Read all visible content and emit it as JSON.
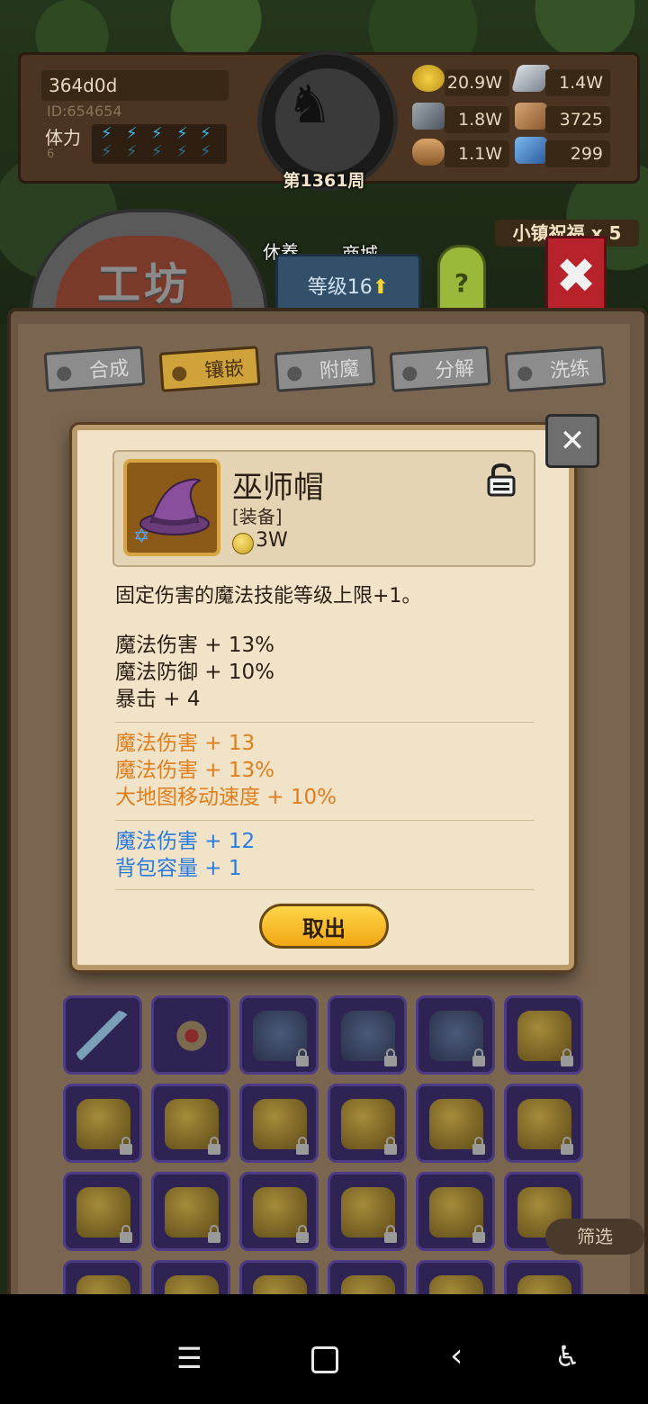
{
  "hud": {
    "player_name": "364d0d",
    "player_id": "ID:654654",
    "stamina_label": "体力",
    "stamina_value": "6",
    "week_label": "第1361周",
    "resources": [
      {
        "icon": "gold-coin-icon",
        "value": "20.9W"
      },
      {
        "icon": "iron-ingot-icon",
        "value": "1.4W"
      },
      {
        "icon": "ore-icon",
        "value": "1.8W"
      },
      {
        "icon": "leather-icon",
        "value": "3725"
      },
      {
        "icon": "wood-log-icon",
        "value": "1.1W"
      },
      {
        "icon": "crystal-icon",
        "value": "299"
      }
    ]
  },
  "buildings": {
    "rest_label": "休养",
    "shop_label": "商城",
    "workshop_label": "工坊",
    "level_label": "等级16",
    "help_label": "?",
    "blessing_label": "小镇祝福 x 5"
  },
  "tabs": [
    {
      "label": "合成",
      "active": false
    },
    {
      "label": "镶嵌",
      "active": true
    },
    {
      "label": "附魔",
      "active": false
    },
    {
      "label": "分解",
      "active": false
    },
    {
      "label": "洗练",
      "active": false
    }
  ],
  "modal": {
    "item_name": "巫师帽",
    "item_type": "[装备]",
    "item_price": "3W",
    "description": "固定伤害的魔法技能等级上限+1。",
    "base_stats": [
      "魔法伤害 + 13%",
      "魔法防御 + 10%",
      "暴击 + 4"
    ],
    "orange_stats": [
      "魔法伤害 + 13",
      "魔法伤害 + 13%",
      "大地图移动速度 + 10%"
    ],
    "blue_stats": [
      "魔法伤害 + 12",
      "背包容量 + 1"
    ],
    "takeout_label": "取出"
  },
  "filter_label": "筛选",
  "colors": {
    "orange_stat": "#e07e1c",
    "blue_stat": "#2a7ae0",
    "active_tab": "#cfa33a",
    "takeout_button": "#f1a714"
  }
}
